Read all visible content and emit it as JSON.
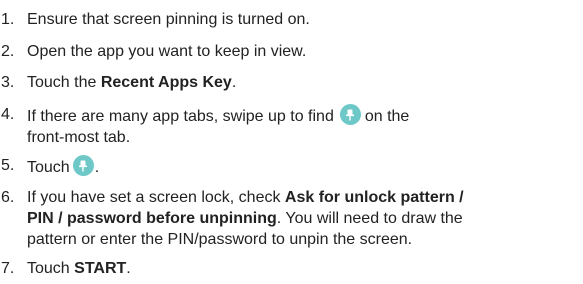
{
  "steps": [
    {
      "num": "1.",
      "text": "Ensure that screen pinning is turned on."
    },
    {
      "num": "2.",
      "text": "Open the app you want to keep in view."
    },
    {
      "num": "3.",
      "pre": "Touch the ",
      "bold": "Recent Apps Key",
      "post": "."
    },
    {
      "num": "4.",
      "pre": "If there are many app tabs, swipe up to find",
      "post_line1": "on the",
      "line2": "front-most tab."
    },
    {
      "num": "5.",
      "pre": "Touch",
      "post": "."
    },
    {
      "num": "6.",
      "pre": "If you have set a screen lock, check ",
      "bold_line1": "Ask for unlock pattern /",
      "bold_line2": "PIN / password before unpinning",
      "post_line2": ". You will need to draw the",
      "line3": "pattern or enter the PIN/password to unpin the screen."
    },
    {
      "num": "7.",
      "pre": "Touch ",
      "bold": "START",
      "post": "."
    }
  ],
  "icons": {
    "pin": "pin-icon",
    "pin_color": "#6ec8c8"
  }
}
